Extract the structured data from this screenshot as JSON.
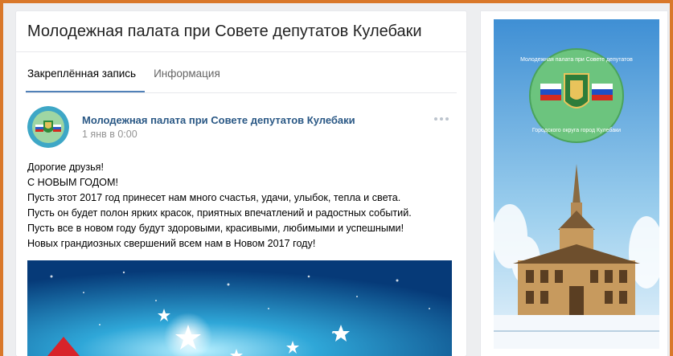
{
  "page": {
    "title": "Молодежная палата при Совете депутатов Кулебаки"
  },
  "tabs": [
    {
      "label": "Закреплённая запись",
      "active": true
    },
    {
      "label": "Информация",
      "active": false
    }
  ],
  "post": {
    "author": "Молодежная палата при Совете депутатов Кулебаки",
    "date": "1 янв в 0:00",
    "lines": [
      "Дорогие друзья!",
      "С НОВЫМ ГОДОМ!",
      "Пусть этот 2017 год принесет нам много счастья, удачи, улыбок, тепла и света.",
      "Пусть он будет полон ярких красок, приятных впечатлений и радостных событий.",
      "Пусть все в новом году будут здоровыми, красивыми, любимыми и успешными!",
      "Новых грандиозных свершений всем нам в Новом 2017 году!"
    ]
  },
  "sidebar": {
    "emblem_text_top": "Молодежная палата при Совете депутатов",
    "emblem_text_bottom": "Городского округа город Кулебаки"
  },
  "colors": {
    "accent": "#5181b8",
    "link": "#2a5885",
    "frame": "#d9782a"
  },
  "icons": {
    "more": "more-dots-icon"
  }
}
